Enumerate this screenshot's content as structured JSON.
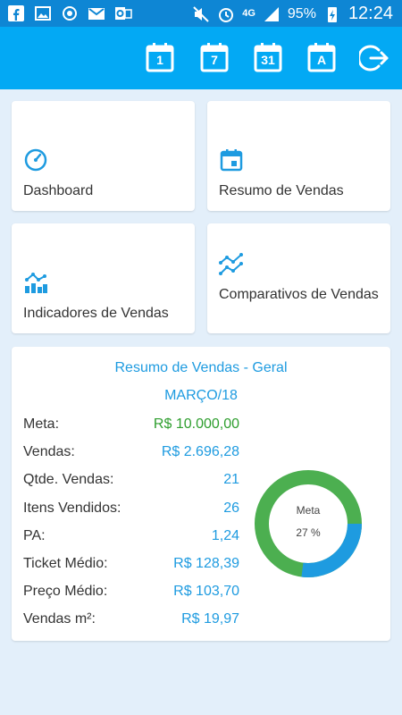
{
  "status_bar": {
    "battery": "95%",
    "network": "4G",
    "time": "12:24"
  },
  "toolbar": {
    "day_label": "1",
    "week_label": "7",
    "month_label": "31",
    "year_label": "A"
  },
  "tiles": [
    {
      "label": "Dashboard",
      "icon": "speedometer-icon"
    },
    {
      "label": "Resumo de Vendas",
      "icon": "calendar-icon"
    },
    {
      "label": "Indicadores de Vendas",
      "icon": "bar-chart-icon"
    },
    {
      "label": "Comparativos de Vendas",
      "icon": "line-chart-icon"
    }
  ],
  "summary": {
    "title": "Resumo de Vendas - Geral",
    "period": "MARÇO/18",
    "rows": [
      {
        "label": "Meta:",
        "value": "R$ 10.000,00"
      },
      {
        "label": "Vendas:",
        "value": "R$ 2.696,28"
      },
      {
        "label": "Qtde. Vendas:",
        "value": "21"
      },
      {
        "label": "Itens Vendidos:",
        "value": "26"
      },
      {
        "label": "PA:",
        "value": "1,24"
      },
      {
        "label": "Ticket Médio:",
        "value": "R$ 128,39"
      },
      {
        "label": "Preço Médio:",
        "value": "R$ 103,70"
      },
      {
        "label": "Vendas m²:",
        "value": "R$ 19,97"
      }
    ],
    "donut": {
      "label": "Meta",
      "percent_text": "27 %",
      "percent": 27,
      "progress_color": "#1e9be0",
      "remaining_color": "#4caf50"
    }
  },
  "colors": {
    "status_bar": "#0e86d4",
    "app_bar": "#03a9f4",
    "accent": "#1e9be0",
    "meta_green": "#2e9e2e",
    "background": "#e3effa"
  }
}
